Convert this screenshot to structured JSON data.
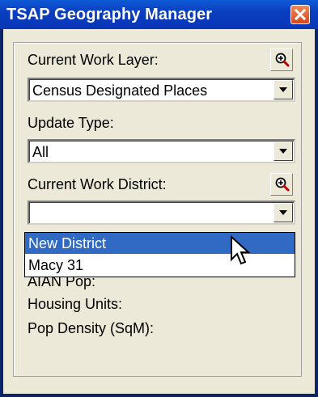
{
  "window": {
    "title": "TSAP Geography Manager"
  },
  "form": {
    "work_layer_label": "Current Work Layer:",
    "work_layer_value": "Census Designated Places",
    "update_type_label": "Update Type:",
    "update_type_value": "All",
    "work_district_label": "Current Work District:",
    "work_district_value": "",
    "aian_pop_label": "AIAN Pop:",
    "housing_units_label": "Housing Units:",
    "pop_density_label": "Pop Density (SqM):"
  },
  "dropdown": {
    "items": [
      {
        "label": "New District",
        "selected": true
      },
      {
        "label": "Macy 31",
        "selected": false
      }
    ]
  },
  "icons": {
    "close": "close-icon",
    "zoom": "zoom-in-icon",
    "dropdown_arrow": "chevron-down-icon",
    "cursor": "arrow-cursor-icon"
  },
  "colors": {
    "titlebar": "#0a3fc0",
    "selection": "#316ac5",
    "panel": "#ece9d8",
    "close_button": "#d8451c"
  }
}
